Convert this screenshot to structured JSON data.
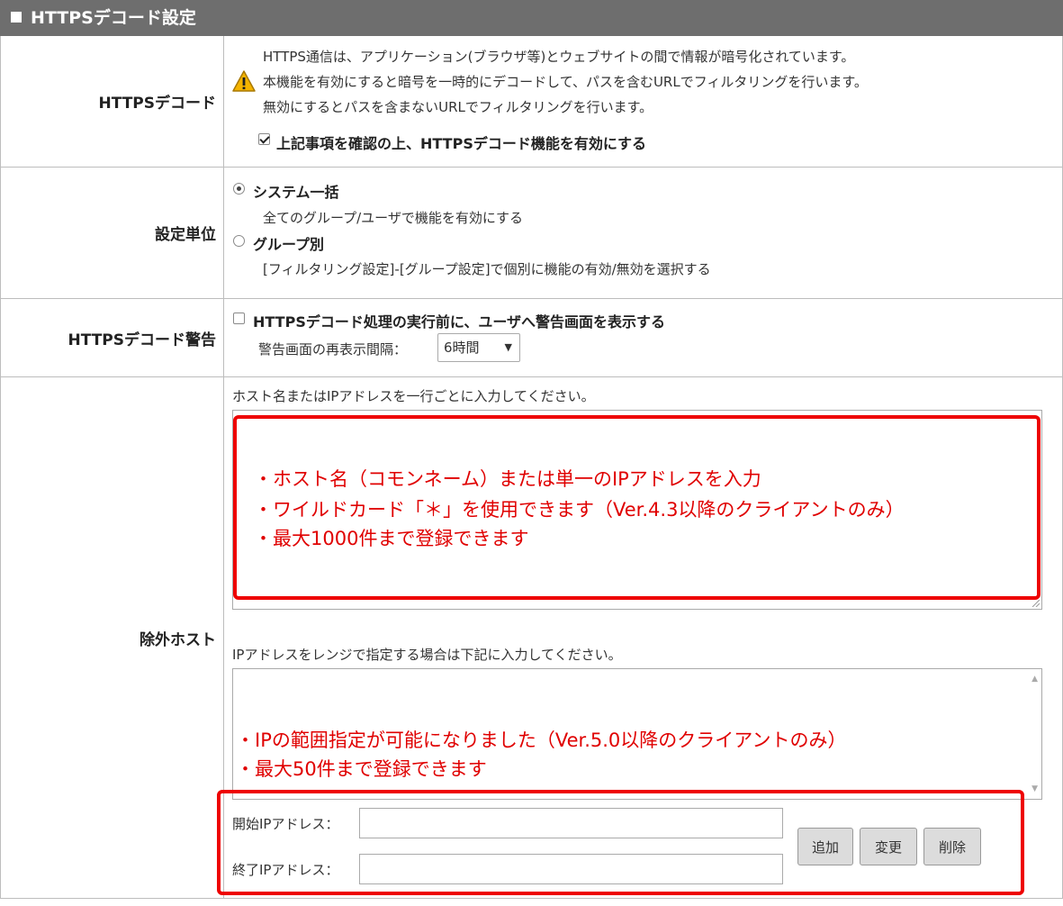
{
  "header": {
    "title": "HTTPSデコード設定"
  },
  "https_decode": {
    "label": "HTTPSデコード",
    "desc1": "HTTPS通信は、アプリケーション(ブラウザ等)とウェブサイトの間で情報が暗号化されています。",
    "desc2": "本機能を有効にすると暗号を一時的にデコードして、パスを含むURLでフィルタリングを行います。",
    "desc3": "無効にするとパスを含まないURLでフィルタリングを行います。",
    "confirm_label": "上記事項を確認の上、HTTPSデコード機能を有効にする",
    "confirm_checked": true
  },
  "unit": {
    "label": "設定単位",
    "option1": "システム一括",
    "option1_desc": "全てのグループ/ユーザで機能を有効にする",
    "option2": "グループ別",
    "option2_desc": "[フィルタリング設定]-[グループ設定]で個別に機能の有効/無効を選択する",
    "selected": "option1"
  },
  "warning": {
    "label": "HTTPSデコード警告",
    "checkbox_label": "HTTPSデコード処理の実行前に、ユーザへ警告画面を表示する",
    "checked": false,
    "interval_label": "警告画面の再表示間隔：",
    "interval_value": "6時間"
  },
  "exclude": {
    "label": "除外ホスト",
    "hosts_instruction": "ホスト名またはIPアドレスを一行ごとに入力してください。",
    "range_instruction": "IPアドレスをレンジで指定する場合は下記に入力してください。",
    "start_label": "開始IPアドレス：",
    "end_label": "終了IPアドレス：",
    "start_value": "",
    "end_value": "",
    "buttons": {
      "add": "追加",
      "edit": "変更",
      "delete": "削除"
    }
  },
  "annotations": {
    "hosts": [
      "・ホスト名（コモンネーム）または単一のIPアドレスを入力",
      "・ワイルドカード「＊」を使用できます（Ver.4.3以降のクライアントのみ）",
      "・最大1000件まで登録できます"
    ],
    "range": [
      "・IPの範囲指定が可能になりました（Ver.5.0以降のクライアントのみ）",
      "・最大50件まで登録できます"
    ],
    "color": "#e00000"
  },
  "icons": {
    "warning": "warning-triangle-icon",
    "dropdown": "chevron-down-icon",
    "resize": "resize-grip-icon"
  }
}
